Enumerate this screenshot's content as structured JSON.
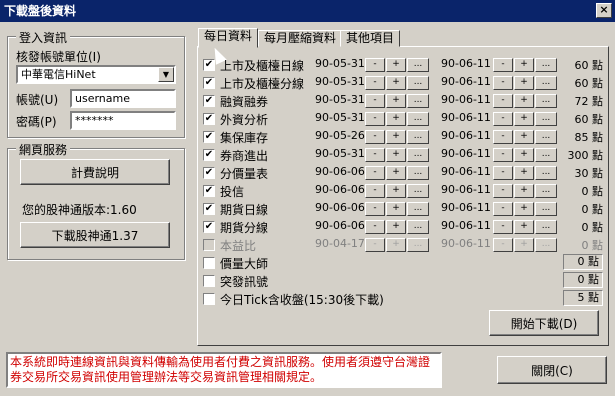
{
  "window": {
    "title": "下載盤後資料",
    "close_glyph": "×"
  },
  "login": {
    "group_title": "登入資訊",
    "provider_label": "核發帳號單位(I)",
    "provider_value": "中華電信HiNet",
    "account_label": "帳號(U)",
    "account_value": "username",
    "password_label": "密碼(P)",
    "password_value": "*******"
  },
  "web": {
    "group_title": "網頁服務",
    "billing_button": "計費說明",
    "version_text": "您的股神通版本:1.60",
    "download_button": "下載股神通1.37"
  },
  "tabs": [
    {
      "label": "每日資料",
      "active": true
    },
    {
      "label": "每月壓縮資料",
      "active": false
    },
    {
      "label": "其他項目",
      "active": false
    }
  ],
  "button_glyphs": {
    "minus": "-",
    "plus": "+",
    "more": "..."
  },
  "rows": [
    {
      "name": "上市及櫃檯日線",
      "checked": true,
      "start": "90-05-31",
      "end": "90-06-11",
      "points": "60 點",
      "dates": true,
      "enabled": true
    },
    {
      "name": "上市及櫃檯分線",
      "checked": true,
      "start": "90-05-31",
      "end": "90-06-11",
      "points": "60 點",
      "dates": true,
      "enabled": true
    },
    {
      "name": "融資融券",
      "checked": true,
      "start": "90-05-31",
      "end": "90-06-11",
      "points": "72 點",
      "dates": true,
      "enabled": true
    },
    {
      "name": "外資分析",
      "checked": true,
      "start": "90-05-31",
      "end": "90-06-11",
      "points": "60 點",
      "dates": true,
      "enabled": true
    },
    {
      "name": "集保庫存",
      "checked": true,
      "start": "90-05-26",
      "end": "90-06-11",
      "points": "85 點",
      "dates": true,
      "enabled": true
    },
    {
      "name": "券商進出",
      "checked": true,
      "start": "90-05-31",
      "end": "90-06-11",
      "points": "300 點",
      "dates": true,
      "enabled": true
    },
    {
      "name": "分價量表",
      "checked": true,
      "start": "90-06-06",
      "end": "90-06-11",
      "points": "30 點",
      "dates": true,
      "enabled": true
    },
    {
      "name": "投信",
      "checked": true,
      "start": "90-06-06",
      "end": "90-06-11",
      "points": "0 點",
      "dates": true,
      "enabled": true
    },
    {
      "name": "期貨日線",
      "checked": true,
      "start": "90-06-06",
      "end": "90-06-11",
      "points": "0 點",
      "dates": true,
      "enabled": true
    },
    {
      "name": "期貨分線",
      "checked": true,
      "start": "90-06-06",
      "end": "90-06-11",
      "points": "0 點",
      "dates": true,
      "enabled": true
    },
    {
      "name": "本益比",
      "checked": false,
      "start": "90-04-17",
      "end": "90-06-11",
      "points": "0 點",
      "dates": true,
      "enabled": false
    },
    {
      "name": "價量大師",
      "checked": false,
      "points": "0 點",
      "dates": false,
      "enabled": true
    },
    {
      "name": "突發訊號",
      "checked": false,
      "points": "0 點",
      "dates": false,
      "enabled": true
    },
    {
      "name": "今日Tick含收盤(15:30後下載)",
      "checked": false,
      "points": "5 點",
      "dates": false,
      "enabled": true
    }
  ],
  "actions": {
    "start_download": "開始下載(D)",
    "close": "關閉(C)"
  },
  "message": "本系統即時連線資訊與資料傳輸為使用者付費之資訊服務。使用者須遵守台灣證券交易所交易資訊使用管理辦法等交易資訊管理相關規定。"
}
